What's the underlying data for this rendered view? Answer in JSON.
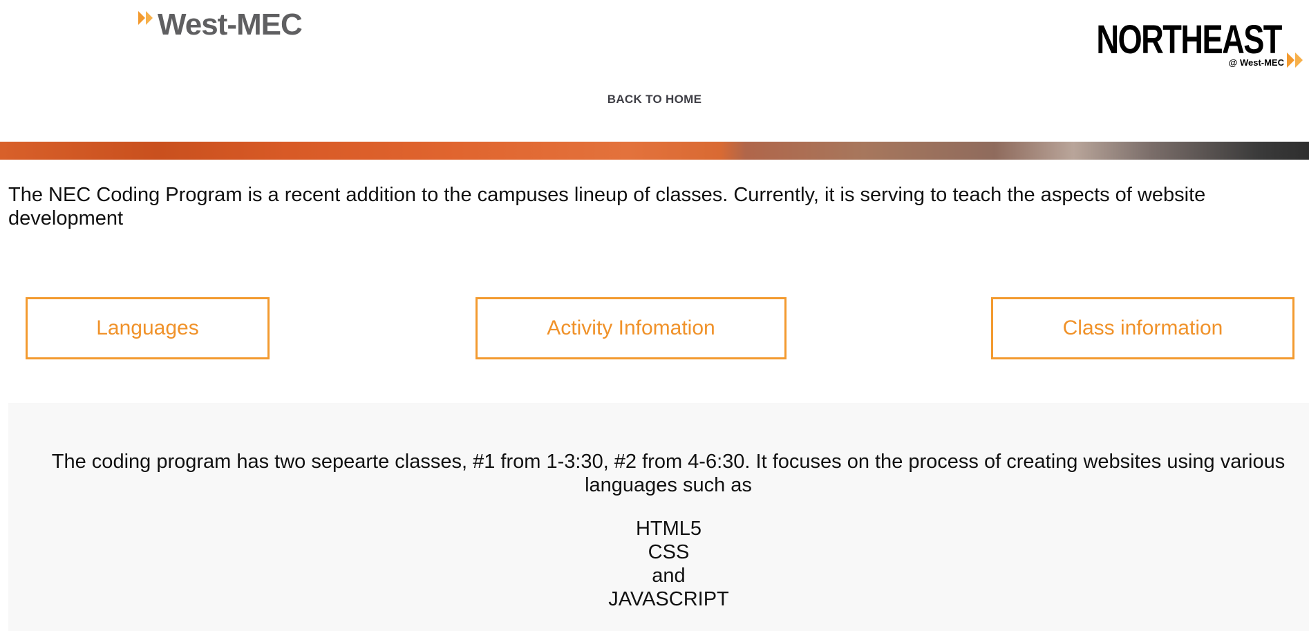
{
  "header": {
    "logo_left": "West-MEC",
    "logo_right_main": "NORTHEAST",
    "logo_right_sub": "@ West-MEC",
    "back_link": "BACK TO HOME",
    "accent_color": "#f39a2f",
    "logo_gray": "#5f5f61"
  },
  "intro": {
    "text": "The NEC Coding Program is a recent addition to the campuses lineup of classes. Currently, it is serving to teach the aspects of website development"
  },
  "buttons": {
    "languages": "Languages",
    "activity": "Activity Infomation",
    "class_info": "Class information"
  },
  "info": {
    "text": "The coding program has two sepearte classes, #1 from 1-3:30, #2 from 4-6:30. It focuses on the process of creating websites using various languages such as",
    "languages": [
      "HTML5",
      "CSS",
      "and",
      "JAVASCRIPT"
    ]
  },
  "icons": {
    "logo_chevrons": "double-chevron-right-icon"
  }
}
